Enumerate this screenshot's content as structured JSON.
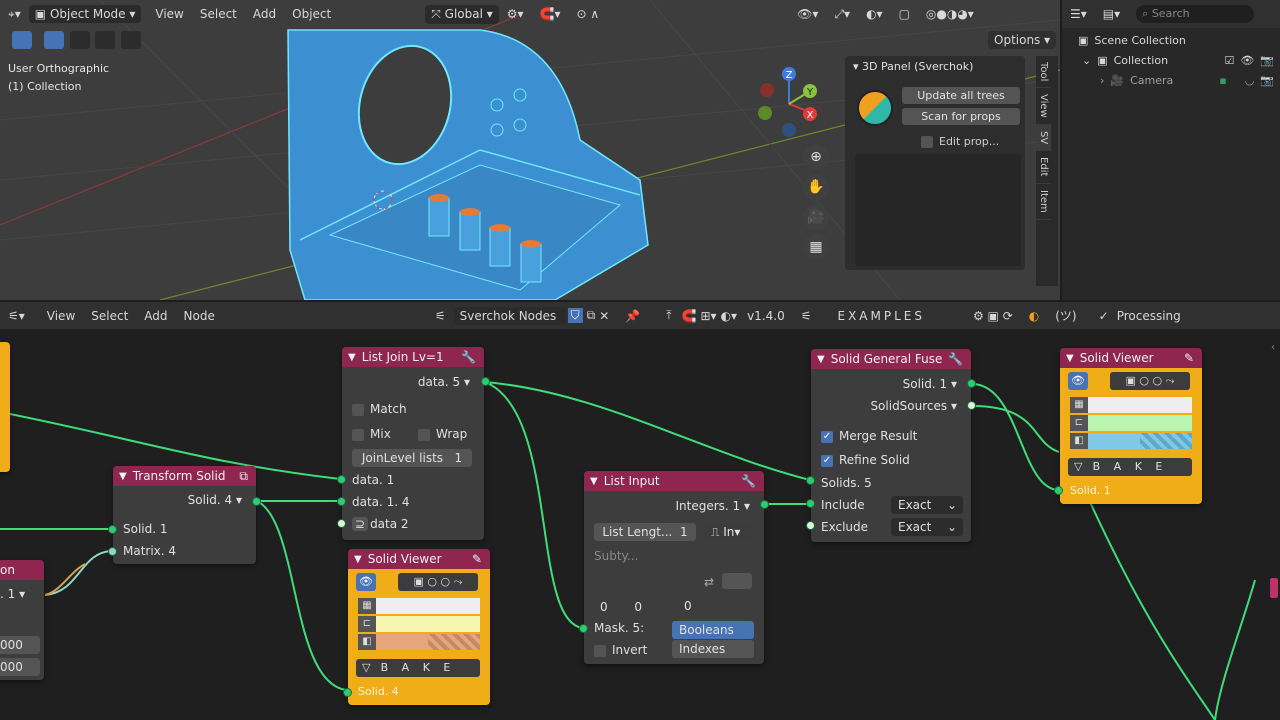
{
  "viewport": {
    "header": {
      "mode": "Object Mode",
      "menus": [
        "View",
        "Select",
        "Add",
        "Object"
      ],
      "orientation": "Global",
      "options_label": "Options"
    },
    "overlay": {
      "view_name": "User Orthographic",
      "collection": "(1) Collection"
    },
    "gizmo": {
      "x": "X",
      "y": "Y",
      "z": "Z"
    },
    "panel": {
      "title": "3D Panel (Sverchok)",
      "update_label": "Update all trees",
      "scan_label": "Scan for props",
      "edit_label": "Edit prop..."
    },
    "side_tabs": [
      "Tool",
      "View",
      "SV",
      "Edit",
      "Item"
    ]
  },
  "outliner": {
    "search_placeholder": "Search",
    "scene_label": "Scene Collection",
    "collection_label": "Collection",
    "camera_label": "Camera"
  },
  "node_editor": {
    "menus": [
      "View",
      "Select",
      "Add",
      "Node"
    ],
    "tree_name": "Sverchok Nodes",
    "version": "v1.4.0",
    "examples": "EXAMPLES",
    "shrug": "(ツ)",
    "processing": "Processing",
    "nodes": {
      "list_join": {
        "title": "List Join Lv=1",
        "output": "data. 5",
        "match": "Match",
        "mix": "Mix",
        "wrap": "Wrap",
        "joinlevel_label": "JoinLevel lists",
        "joinlevel_value": "1",
        "in1": "data. 1",
        "in2": "data. 1. 4",
        "in3": "data 2"
      },
      "transform": {
        "title": "Transform Solid",
        "output": "Solid. 4",
        "in1": "Solid. 1",
        "in2": "Matrix. 4"
      },
      "viewer_a": {
        "title": "Solid Viewer",
        "bake": "B A K E",
        "input": "Solid. 4"
      },
      "list_input": {
        "title": "List Input",
        "output": "Integers. 1",
        "length_label": "List Lengt...",
        "length_value": "1",
        "in_label": "In",
        "subtype": "Subty...",
        "v1": "0",
        "v2": "0",
        "v3": "0",
        "mask": "Mask. 5:",
        "booleans": "Booleans",
        "indexes": "Indexes",
        "invert": "Invert"
      },
      "fuse": {
        "title": "Solid General Fuse",
        "out1": "Solid. 1",
        "out2": "SolidSources",
        "merge": "Merge Result",
        "refine": "Refine Solid",
        "in1": "Solids. 5",
        "in2": "Include",
        "in2_mode": "Exact",
        "in3": "Exclude",
        "in3_mode": "Exact"
      },
      "viewer_b": {
        "title": "Solid Viewer",
        "bake": "B A K E",
        "input": "Solid. 1"
      },
      "left_partial": {
        "title_tail": "on",
        "value": ". 1",
        "f1": "000",
        "f2": "000"
      }
    }
  }
}
